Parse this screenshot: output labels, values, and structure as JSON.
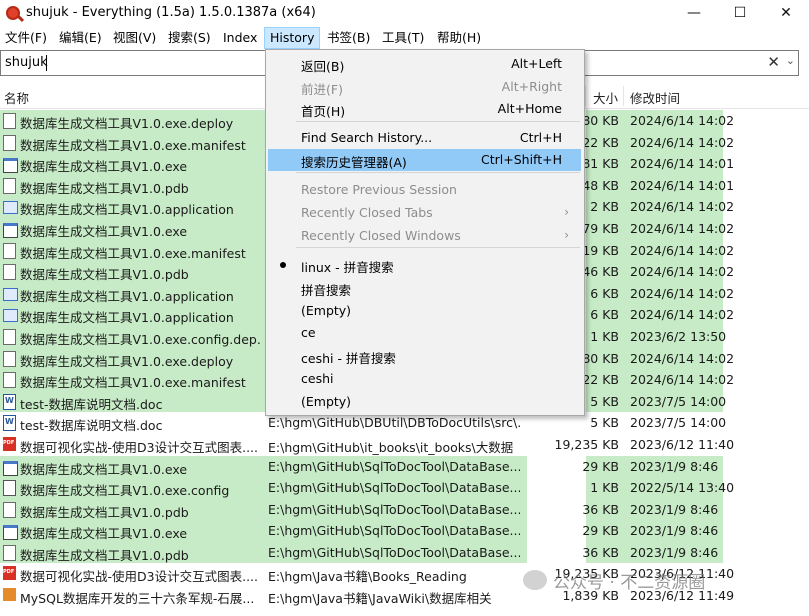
{
  "window": {
    "title": "shujuk - Everything (1.5a) 1.5.0.1387a (x64)",
    "minimize": "—",
    "maximize": "☐",
    "close": "✕"
  },
  "menubar": {
    "items": [
      "文件(F)",
      "编辑(E)",
      "视图(V)",
      "搜索(S)",
      "Index",
      "History",
      "书签(B)",
      "工具(T)",
      "帮助(H)"
    ]
  },
  "search": {
    "value": "shujuk",
    "clear_icon": "✕",
    "dropdown_icon": "⌄"
  },
  "columns": {
    "name": "名称",
    "size": "大小",
    "modified": "修改时间"
  },
  "rows": [
    {
      "icon": "doc",
      "name": "数据库生成文档工具V1.0.exe.deploy",
      "path": "",
      "size": "80 KB",
      "date": "2024/6/14 14:02",
      "hl": true
    },
    {
      "icon": "doc",
      "name": "数据库生成文档工具V1.0.exe.manifest",
      "path": "",
      "size": "22 KB",
      "date": "2024/6/14 14:02",
      "hl": true
    },
    {
      "icon": "exe",
      "name": "数据库生成文档工具V1.0.exe",
      "path": "",
      "size": "81 KB",
      "date": "2024/6/14 14:01",
      "hl": true
    },
    {
      "icon": "doc",
      "name": "数据库生成文档工具V1.0.pdb",
      "path": "",
      "size": "48 KB",
      "date": "2024/6/14 14:01",
      "hl": true
    },
    {
      "icon": "app",
      "name": "数据库生成文档工具V1.0.application",
      "path": "",
      "size": "2 KB",
      "date": "2024/6/14 14:02",
      "hl": true
    },
    {
      "icon": "exe",
      "name": "数据库生成文档工具V1.0.exe",
      "path": "",
      "size": "79 KB",
      "date": "2024/6/14 14:02",
      "hl": true
    },
    {
      "icon": "doc",
      "name": "数据库生成文档工具V1.0.exe.manifest",
      "path": "",
      "size": "19 KB",
      "date": "2024/6/14 14:02",
      "hl": true
    },
    {
      "icon": "doc",
      "name": "数据库生成文档工具V1.0.pdb",
      "path": "",
      "size": "46 KB",
      "date": "2024/6/14 14:02",
      "hl": true
    },
    {
      "icon": "app",
      "name": "数据库生成文档工具V1.0.application",
      "path": "",
      "size": "6 KB",
      "date": "2024/6/14 14:02",
      "hl": true
    },
    {
      "icon": "app",
      "name": "数据库生成文档工具V1.0.application",
      "path": "",
      "size": "6 KB",
      "date": "2024/6/14 14:02",
      "hl": true
    },
    {
      "icon": "doc",
      "name": "数据库生成文档工具V1.0.exe.config.dep...",
      "path": "",
      "size": "1 KB",
      "date": "2023/6/2 13:50",
      "hl": true
    },
    {
      "icon": "doc",
      "name": "数据库生成文档工具V1.0.exe.deploy",
      "path": "",
      "size": "80 KB",
      "date": "2024/6/14 14:02",
      "hl": true
    },
    {
      "icon": "doc",
      "name": "数据库生成文档工具V1.0.exe.manifest",
      "path": "",
      "size": "22 KB",
      "date": "2024/6/14 14:02",
      "hl": true
    },
    {
      "icon": "word",
      "name": "test-数据库说明文档.doc",
      "path": "",
      "size": "5 KB",
      "date": "2023/7/5 14:00",
      "hl": true
    },
    {
      "icon": "word",
      "name": "test-数据库说明文档.doc",
      "path": "E:\\hgm\\GitHub\\DBUtil\\DBToDocUtils\\src\\...",
      "size": "5 KB",
      "date": "2023/7/5 14:00",
      "hl": false
    },
    {
      "icon": "pdf",
      "name": "数据可视化实战-使用D3设计交互式图表....",
      "path": "E:\\hgm\\GitHub\\it_books\\it_books\\大数据",
      "size": "19,235 KB",
      "date": "2023/6/12 11:40",
      "hl": false
    },
    {
      "icon": "exe",
      "name": "数据库生成文档工具V1.0.exe",
      "path": "E:\\hgm\\GitHub\\SqlToDocTool\\DataBase...",
      "size": "29 KB",
      "date": "2023/1/9 8:46",
      "hl": true
    },
    {
      "icon": "cfg",
      "name": "数据库生成文档工具V1.0.exe.config",
      "path": "E:\\hgm\\GitHub\\SqlToDocTool\\DataBase...",
      "size": "1 KB",
      "date": "2022/5/14 13:40",
      "hl": true
    },
    {
      "icon": "doc",
      "name": "数据库生成文档工具V1.0.pdb",
      "path": "E:\\hgm\\GitHub\\SqlToDocTool\\DataBase...",
      "size": "36 KB",
      "date": "2023/1/9 8:46",
      "hl": true
    },
    {
      "icon": "exe",
      "name": "数据库生成文档工具V1.0.exe",
      "path": "E:\\hgm\\GitHub\\SqlToDocTool\\DataBase...",
      "size": "29 KB",
      "date": "2023/1/9 8:46",
      "hl": true
    },
    {
      "icon": "doc",
      "name": "数据库生成文档工具V1.0.pdb",
      "path": "E:\\hgm\\GitHub\\SqlToDocTool\\DataBase...",
      "size": "36 KB",
      "date": "2023/1/9 8:46",
      "hl": true
    },
    {
      "icon": "pdf",
      "name": "数据可视化实战-使用D3设计交互式图表....",
      "path": "E:\\hgm\\Java书籍\\Books_Reading",
      "size": "19,235 KB",
      "date": "2023/6/12 11:40",
      "hl": false
    },
    {
      "icon": "img",
      "name": "MySQL数据库开发的三十六条军规-石展...",
      "path": "E:\\hgm\\Java书籍\\JavaWiki\\数据库相关",
      "size": "1,839 KB",
      "date": "2023/6/12 11:49",
      "hl": false
    }
  ],
  "history_menu": {
    "items": [
      {
        "label": "返回(B)",
        "shortcut": "Alt+Left",
        "disabled": false
      },
      {
        "label": "前进(F)",
        "shortcut": "Alt+Right",
        "disabled": true
      },
      {
        "label": "首页(H)",
        "shortcut": "Alt+Home",
        "disabled": false
      },
      {
        "label": "Find Search History...",
        "shortcut": "Ctrl+H",
        "disabled": false
      },
      {
        "label": "搜索历史管理器(A)",
        "shortcut": "Ctrl+Shift+H",
        "disabled": false,
        "highlighted": true
      },
      {
        "label": "Restore Previous Session",
        "shortcut": "",
        "disabled": true
      },
      {
        "label": "Recently Closed Tabs",
        "shortcut": "",
        "disabled": true,
        "submenu": true
      },
      {
        "label": "Recently Closed Windows",
        "shortcut": "",
        "disabled": true,
        "submenu": true
      },
      {
        "label": "linux - 拼音搜索",
        "shortcut": "",
        "disabled": false,
        "checked": true
      },
      {
        "label": "拼音搜索",
        "shortcut": "",
        "disabled": false
      },
      {
        "label": "(Empty)",
        "shortcut": "",
        "disabled": false
      },
      {
        "label": "ce",
        "shortcut": "",
        "disabled": false
      },
      {
        "label": "ceshi - 拼音搜索",
        "shortcut": "",
        "disabled": false
      },
      {
        "label": "ceshi",
        "shortcut": "",
        "disabled": false
      },
      {
        "label": "(Empty)",
        "shortcut": "",
        "disabled": false
      }
    ],
    "submenu_arrow": "›"
  },
  "watermark": {
    "text": "公众号 · 不二资源圈"
  },
  "colors": {
    "match_highlight": "#c7ebc7",
    "menu_highlight": "#91c9f7",
    "active_menu": "#cce8ff"
  }
}
